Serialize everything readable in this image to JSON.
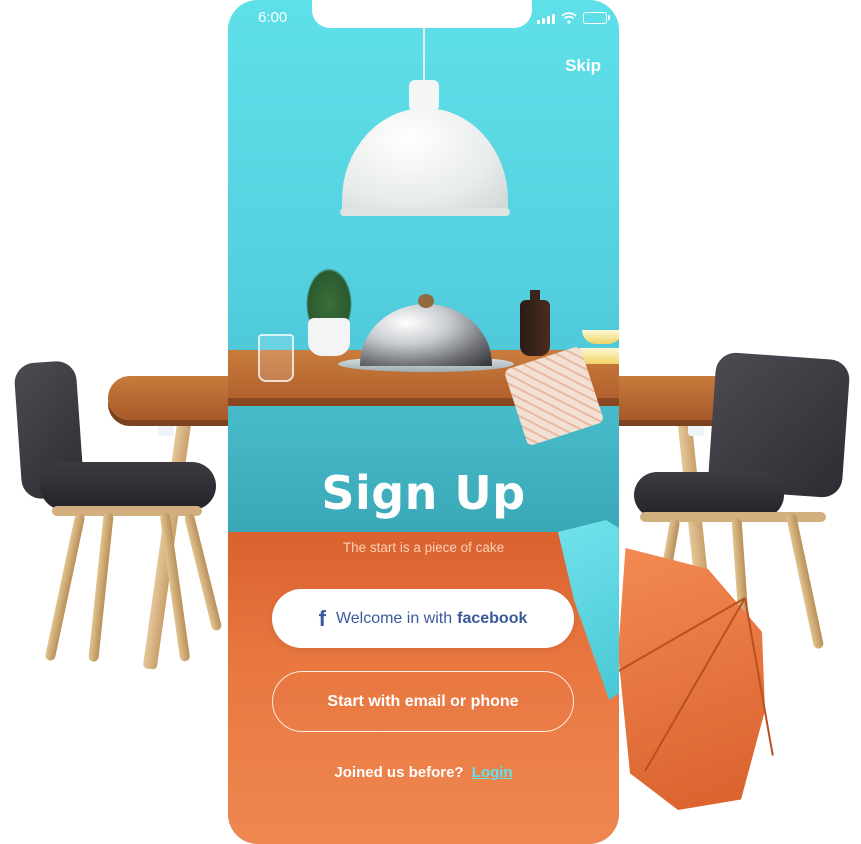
{
  "status_bar": {
    "time": "6:00"
  },
  "header": {
    "skip_label": "Skip"
  },
  "main": {
    "title": "Sign Up",
    "subtitle": "The start is a piece of cake",
    "facebook_button": {
      "prefix": "Welcome in with",
      "brand": "facebook"
    },
    "email_button_label": "Start with email or phone",
    "login_prompt": "Joined us before?",
    "login_link": "Login"
  },
  "icons": {
    "facebook": "facebook-icon",
    "signal": "signal-icon",
    "wifi": "wifi-icon",
    "battery": "battery-icon"
  },
  "colors": {
    "sky": "#5ad7e3",
    "floor": "#e8763f",
    "facebook_blue": "#3b5998",
    "login_link": "#5fe4ef"
  }
}
